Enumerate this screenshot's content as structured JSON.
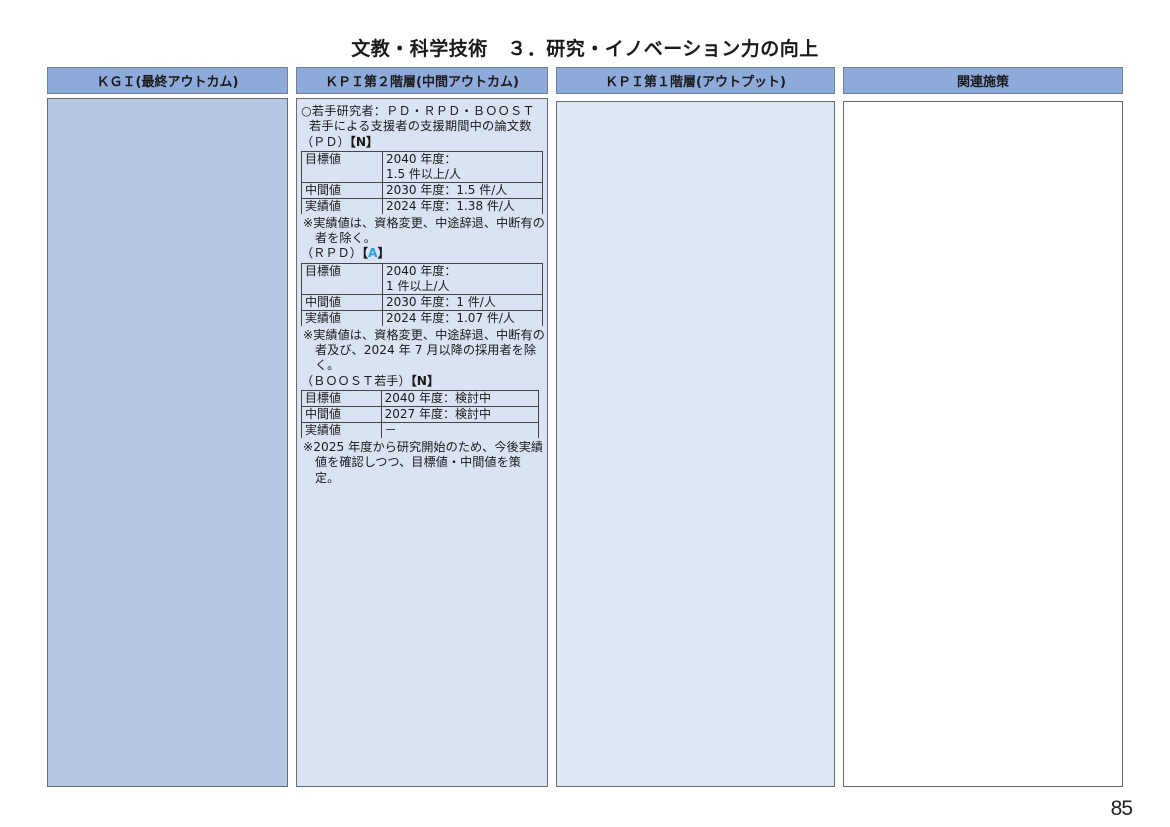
{
  "title": "文教・科学技術　３．研究・イノベーション力の向上",
  "headers": {
    "kgi": "ＫＧＩ(最終アウトカム)",
    "kpi2": "ＫＰＩ第２階層(中間アウトカム)",
    "kpi1": "ＫＰＩ第１階層(アウトプット)",
    "related": "関連施策"
  },
  "kpi2": {
    "metric": "○若手研究者：ＰＤ・ＲＰＤ・ＢＯＯＳＴ若手による支援者の支援期間中の論文数",
    "groups": [
      {
        "label": "（ＰＤ）",
        "grade": "N",
        "rows": [
          {
            "k": "目標値",
            "v": "2040 年度：",
            "v2": "1.5 件以上/人"
          },
          {
            "k": "中間値",
            "v": "2030 年度：1.5 件/人"
          },
          {
            "k": "実績値",
            "v": "2024 年度：1.38 件/人"
          }
        ],
        "note": "※実績値は、資格変更、中途辞退、中断有の者を除く。"
      },
      {
        "label": "（ＲＰＤ）",
        "grade": "A",
        "rows": [
          {
            "k": "目標値",
            "v": "2040 年度：",
            "v2": "1 件以上/人"
          },
          {
            "k": "中間値",
            "v": "2030 年度：1 件/人"
          },
          {
            "k": "実績値",
            "v": "2024 年度：1.07 件/人"
          }
        ],
        "note": "※実績値は、資格変更、中途辞退、中断有の者及び、2024 年 7 月以降の採用者を除く。"
      },
      {
        "label": "（ＢＯＯＳＴ若手）",
        "grade": "N",
        "rows": [
          {
            "k": "目標値",
            "v": "2040 年度：検討中"
          },
          {
            "k": "中間値",
            "v": "2027 年度：検討中"
          },
          {
            "k": "実績値",
            "v": "－"
          }
        ],
        "note": "※2025 年度から研究開始のため、今後実績値を確認しつつ、目標値・中間値を策定。"
      }
    ]
  },
  "page_number": "85"
}
